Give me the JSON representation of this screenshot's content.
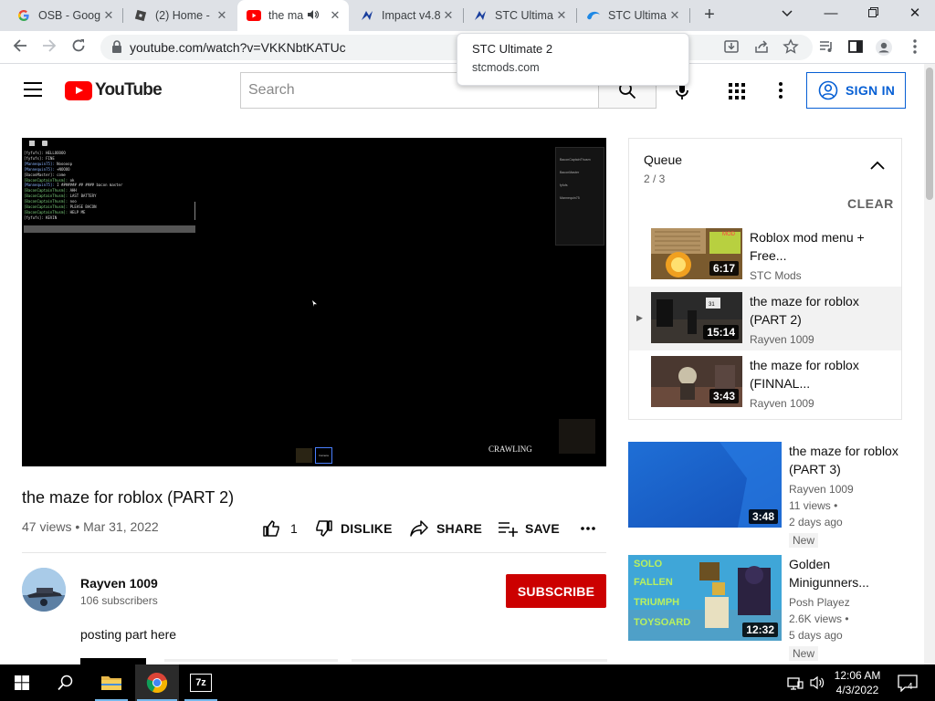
{
  "browser": {
    "tabs": [
      {
        "title": "OSB - Goog",
        "icon": "google-g-icon"
      },
      {
        "title": "(2) Home -",
        "icon": "roblox-icon"
      },
      {
        "title": "the ma",
        "icon": "youtube-icon",
        "active": true,
        "audio": true
      },
      {
        "title": "Impact v4.8",
        "icon": "impact-icon"
      },
      {
        "title": "STC Ultima",
        "icon": "stc-icon"
      },
      {
        "title": "STC Ultima",
        "icon": "edge-like-icon"
      }
    ],
    "new_tab_label": "+",
    "url": "youtube.com/watch?v=VKKNbtKATUc",
    "tooltip": {
      "title": "STC Ultimate 2",
      "domain": "stcmods.com"
    }
  },
  "header": {
    "logo_text": "YouTube",
    "search_placeholder": "Search",
    "sign_in_label": "SIGN IN"
  },
  "video": {
    "player": {
      "overlay_text": "CRAWLING",
      "hotbar_label": "Camera",
      "chat_lines": [
        {
          "who": "[fyfufs]:",
          "msg": "HELLOOOOO",
          "c": ""
        },
        {
          "who": "[fyfufs]:",
          "msg": "FINE",
          "c": ""
        },
        {
          "who": "[Mannequin75]:",
          "msg": "Nooooop",
          "c": "b"
        },
        {
          "who": "[Mannequin75]:",
          "msg": "+NOOOO",
          "c": "b"
        },
        {
          "who": "[BaconMaster]:",
          "msg": "come",
          "c": ""
        },
        {
          "who": "[BaconCaptainThusm]:",
          "msg": "ok",
          "c": "g"
        },
        {
          "who": "[Mannequin75]:",
          "msg": "I ####### ## #### bacon master",
          "c": "b"
        },
        {
          "who": "[BaconCaptainThusm]:",
          "msg": "AHH",
          "c": "g"
        },
        {
          "who": "[BaconCaptainThusm]:",
          "msg": "LAST BATTERY",
          "c": "g"
        },
        {
          "who": "[BaconCaptainThusm]:",
          "msg": "noo",
          "c": "g"
        },
        {
          "who": "[BaconCaptainThusm]:",
          "msg": "PLEASE BACON",
          "c": "g"
        },
        {
          "who": "[BaconCaptainThusm]:",
          "msg": "HELP ME",
          "c": "g"
        },
        {
          "who": "[fyfufs]:",
          "msg": "KEVIN",
          "c": ""
        }
      ],
      "player_list": [
        "BaconCaptainThusm",
        "BaconMaster",
        "fyfufs",
        "Mannequin75"
      ]
    },
    "title": "the maze for roblox (PART 2)",
    "meta": "47 views • Mar 31, 2022",
    "actions": {
      "likes": "1",
      "dislike": "DISLIKE",
      "share": "SHARE",
      "save": "SAVE"
    },
    "channel": {
      "name": "Rayven 1009",
      "subscribers": "106 subscribers"
    },
    "subscribe_label": "SUBSCRIBE",
    "description": "posting part here"
  },
  "queue": {
    "title": "Queue",
    "count": "2 / 3",
    "clear_label": "CLEAR",
    "items": [
      {
        "title": "Roblox mod menu + Free...",
        "channel": "STC Mods",
        "duration": "6:17"
      },
      {
        "title": "the maze for roblox (PART 2)",
        "channel": "Rayven 1009",
        "duration": "15:14",
        "playing": true
      },
      {
        "title": "the maze for roblox (FINNAL...",
        "channel": "Rayven 1009",
        "duration": "3:43"
      }
    ]
  },
  "related": [
    {
      "title": "the maze for roblox (PART 3)",
      "channel": "Rayven 1009",
      "views": "11 views •",
      "date": "2 days ago",
      "badge": "New",
      "duration": "3:48"
    },
    {
      "title": "Golden Minigunners...",
      "channel": "Posh Playez",
      "views": "2.6K views •",
      "date": "5 days ago",
      "badge": "New",
      "duration": "12:32",
      "thumb_text": [
        "SOLO",
        "FALLEN",
        "TRIUMPH",
        "TOYSOARD"
      ]
    }
  ],
  "taskbar": {
    "time": "12:06 AM",
    "date": "4/3/2022",
    "notification_count": "4",
    "seven_zip_label": "7z"
  }
}
